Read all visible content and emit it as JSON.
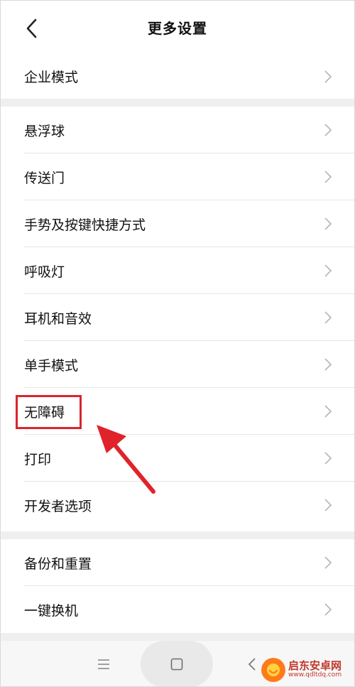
{
  "header": {
    "title": "更多设置",
    "back_icon": "chevron-left-icon"
  },
  "groups": [
    {
      "items": [
        {
          "label": "企业模式"
        }
      ]
    },
    {
      "items": [
        {
          "label": "悬浮球"
        },
        {
          "label": "传送门"
        },
        {
          "label": "手势及按键快捷方式"
        },
        {
          "label": "呼吸灯"
        },
        {
          "label": "耳机和音效"
        },
        {
          "label": "单手模式"
        },
        {
          "label": "无障碍"
        },
        {
          "label": "打印"
        },
        {
          "label": "开发者选项"
        }
      ]
    },
    {
      "items": [
        {
          "label": "备份和重置"
        },
        {
          "label": "一键换机"
        }
      ]
    }
  ],
  "annotation": {
    "highlight_color": "#d9262c",
    "highlighted_item": "无障碍"
  },
  "navbar": {
    "menu_icon": "menu-icon",
    "home_icon": "home-square-icon",
    "back_icon": "back-triangle-icon"
  },
  "watermark": {
    "title": "启东安卓网",
    "url": "www.qdltdq.com"
  },
  "colors": {
    "background": "#ffffff",
    "divider": "#e6e6e6",
    "group_gap": "#efefef",
    "text": "#111111",
    "chevron": "#b5b5b5"
  }
}
